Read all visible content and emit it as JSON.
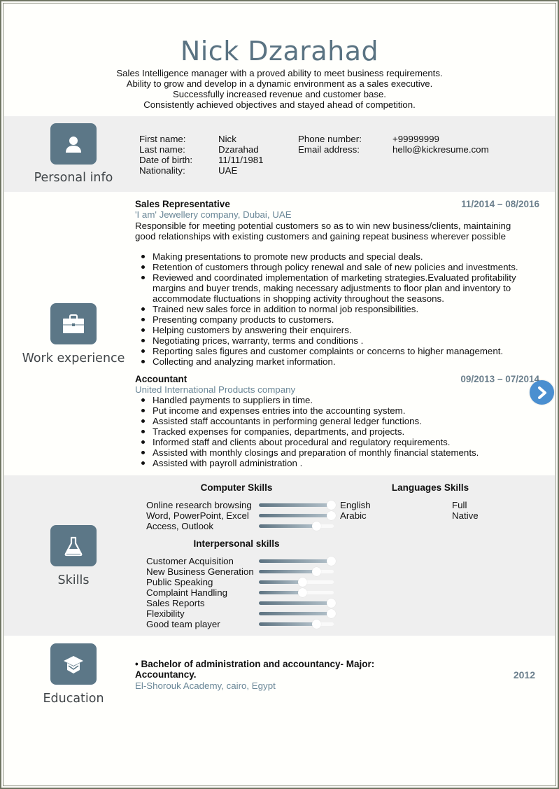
{
  "header": {
    "name": "Nick Dzarahad",
    "summary": [
      "Sales Intelligence manager with a proved ability to meet business requirements.",
      "Ability to grow and develop in a dynamic environment as a sales executive.",
      "Successfully increased revenue and customer base.",
      "Consistently achieved objectives and stayed ahead of competition."
    ]
  },
  "personal": {
    "label": "Personal info",
    "icon": "person-icon",
    "fields_left": [
      {
        "label": "First name:",
        "value": "Nick"
      },
      {
        "label": "Last name:",
        "value": "Dzarahad"
      },
      {
        "label": "Date of birth:",
        "value": "11/11/1981"
      },
      {
        "label": "Nationality:",
        "value": "UAE"
      }
    ],
    "fields_right": [
      {
        "label": "Phone number:",
        "value": "+99999999"
      },
      {
        "label": "Email address:",
        "value": "hello@kickresume.com"
      }
    ]
  },
  "work": {
    "label": "Work experience",
    "icon": "briefcase-icon",
    "jobs": [
      {
        "title": "Sales Representative",
        "dates": "11/2014 – 08/2016",
        "company": "'I am' Jewellery company, Dubai, UAE",
        "description": "Responsible for meeting potential customers so as to win new business/clients, maintaining good relationships with existing customers and gaining repeat business wherever possible",
        "bullets": [
          "Making presentations to promote new products and special deals.",
          "Retention of customers through policy renewal and sale of new policies and investments.",
          "Reviewed and coordinated implementation of marketing strategies.Evaluated profitability margins and buyer trends, making necessary adjustments to floor plan and inventory to accommodate fluctuations in shopping activity throughout the seasons.",
          "Trained new sales force in addition to normal job responsibilities.",
          "Presenting company products to customers.",
          "Helping customers by answering their enquirers.",
          "Negotiating prices, warranty, terms and conditions .",
          "Reporting sales figures and customer complaints or concerns to higher management.",
          "Collecting and analyzing market information."
        ]
      },
      {
        "title": "Accountant",
        "dates": "09/2013 – 07/2014",
        "company": "United International Products company",
        "bullets": [
          "Handled payments to suppliers in time.",
          "Put income and expenses entries into the accounting system.",
          "Assisted staff accountants in performing general ledger functions.",
          "Tracked expenses for companies, departments, and projects.",
          "Informed staff and clients about procedural and regulatory requirements.",
          "Assisted with monthly closings and preparation of monthly financial statements.",
          "Assisted with payroll administration ."
        ]
      }
    ],
    "next_button_icon": "chevron-right-icon"
  },
  "skills": {
    "label": "Skills",
    "icon": "flask-icon",
    "computer_title": "Computer Skills",
    "computer": [
      {
        "name": "Online research browsing",
        "level": 1.0
      },
      {
        "name": "Word, PowerPoint, Excel",
        "level": 1.0
      },
      {
        "name": "Access, Outlook",
        "level": 0.8
      }
    ],
    "languages_title": "Languages Skills",
    "languages": [
      {
        "name": "English",
        "level": "Full"
      },
      {
        "name": "Arabic",
        "level": "Native"
      }
    ],
    "interpersonal_title": "Interpersonal skills",
    "interpersonal": [
      {
        "name": "Customer Acquisition",
        "level": 1.0
      },
      {
        "name": "New Business Generation",
        "level": 0.8
      },
      {
        "name": "Public Speaking",
        "level": 0.6
      },
      {
        "name": "Complaint Handling",
        "level": 0.6
      },
      {
        "name": "Sales Reports",
        "level": 1.0
      },
      {
        "name": "Flexibility",
        "level": 1.0
      },
      {
        "name": "Good team player",
        "level": 0.8
      }
    ]
  },
  "education": {
    "label": "Education",
    "icon": "graduation-cap-icon",
    "degree": "• Bachelor of administration and accountancy- Major: Accountancy.",
    "school": "El-Shorouk Academy, cairo, Egypt",
    "year": "2012"
  }
}
